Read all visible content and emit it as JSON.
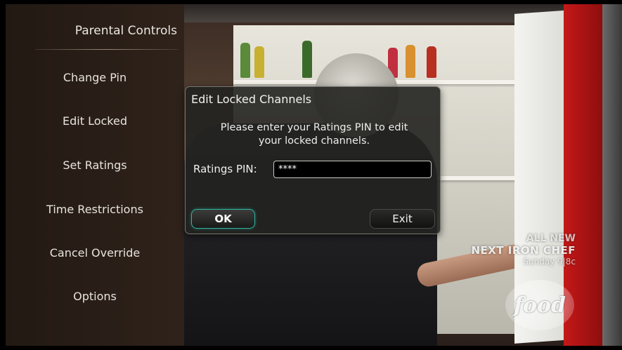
{
  "menu": {
    "title": "Parental Controls",
    "items": [
      {
        "label": "Change Pin"
      },
      {
        "label": "Edit Locked"
      },
      {
        "label": "Set Ratings"
      },
      {
        "label": "Time Restrictions"
      },
      {
        "label": "Cancel Override"
      },
      {
        "label": "Options"
      }
    ]
  },
  "dialog": {
    "title": "Edit Locked Channels",
    "message_line1": "Please enter your Ratings PIN to edit",
    "message_line2": "your locked channels.",
    "pin_label": "Ratings PIN:",
    "pin_value": "****",
    "ok_label": "OK",
    "exit_label": "Exit"
  },
  "video_overlay": {
    "promo_line1": "ALL NEW",
    "promo_line2": "NEXT IRON CHEF",
    "promo_line3": "Sunday 9|8c",
    "channel_logo": "food"
  },
  "colors": {
    "focus_accent": "#2fb3a0",
    "menu_background": "#2e2219",
    "dialog_background": "#222220"
  }
}
